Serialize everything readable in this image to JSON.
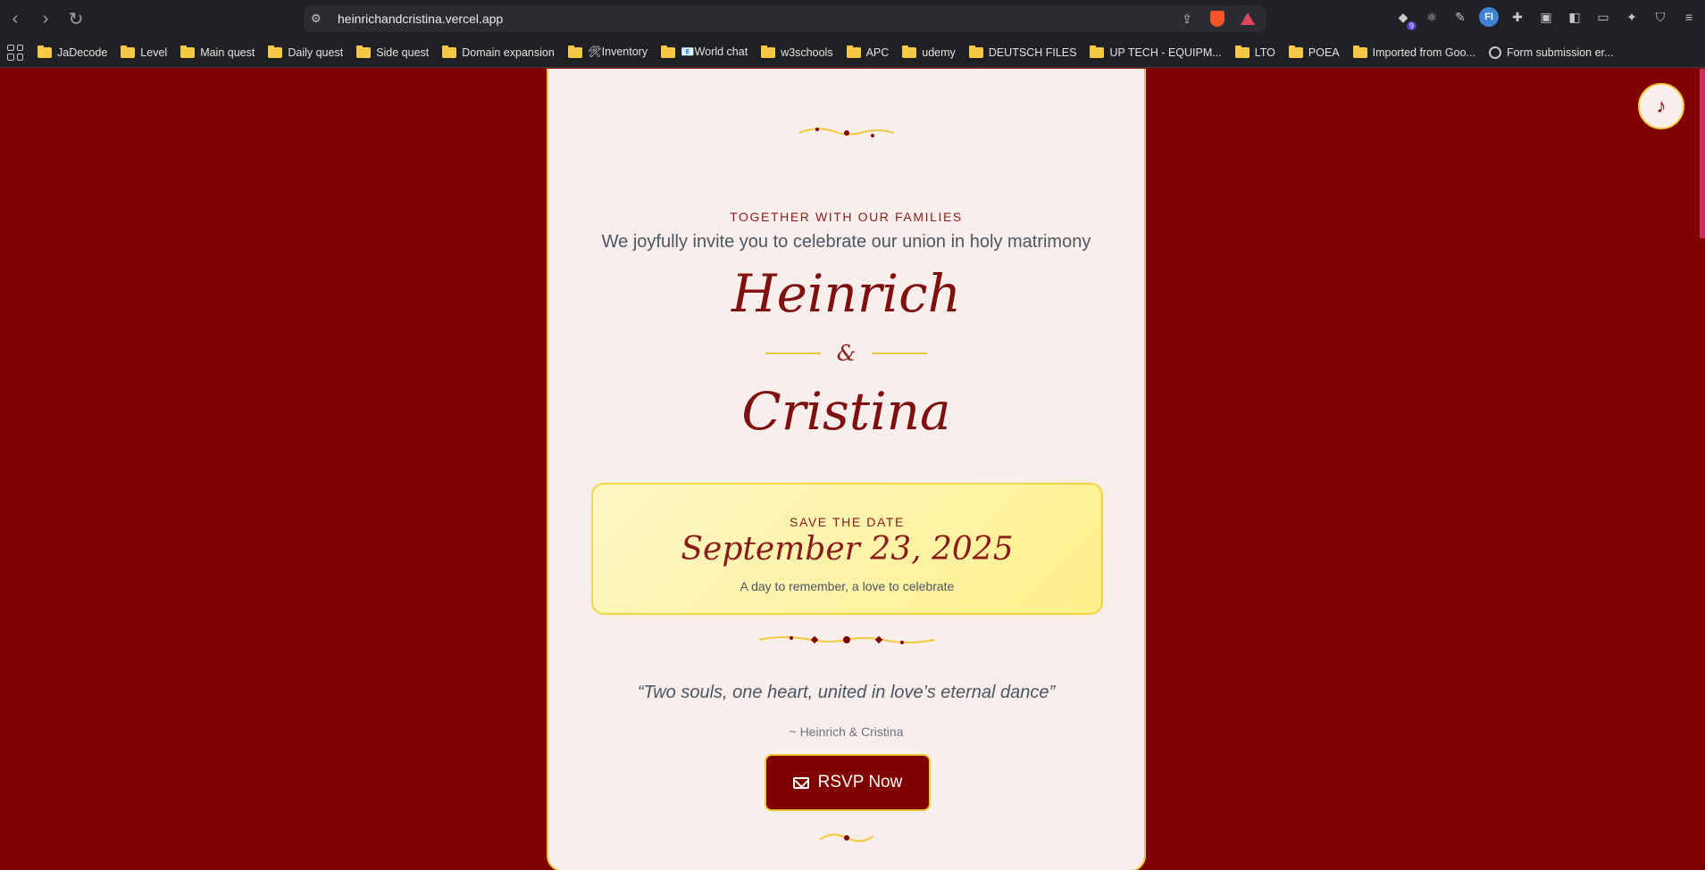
{
  "browser": {
    "url": "heinrichandcristina.vercel.app",
    "extension_badge": "9",
    "extension_fi": "FI"
  },
  "bookmarks": [
    {
      "label": "JaDecode"
    },
    {
      "label": "Level"
    },
    {
      "label": "Main quest"
    },
    {
      "label": "Daily quest"
    },
    {
      "label": "Side quest"
    },
    {
      "label": "Domain expansion"
    },
    {
      "label": "🛠Inventory"
    },
    {
      "label": "📧World chat"
    },
    {
      "label": "w3schools"
    },
    {
      "label": "APC"
    },
    {
      "label": "udemy"
    },
    {
      "label": "DEUTSCH FILES"
    },
    {
      "label": "UP TECH - EQUIPM..."
    },
    {
      "label": "LTO"
    },
    {
      "label": "POEA"
    },
    {
      "label": "Imported from Goo..."
    },
    {
      "label": "Form submission er..."
    }
  ],
  "invitation": {
    "families": "TOGETHER WITH OUR FAMILIES",
    "invite_line": "We joyfully invite you to celebrate our union in holy matrimony",
    "name1": "Heinrich",
    "ampersand": "&",
    "name2": "Cristina",
    "save_label": "SAVE THE DATE",
    "date": "September 23, 2025",
    "date_sub": "A day to remember, a love to celebrate",
    "quote": "“Two souls, one heart, united in love’s eternal dance”",
    "quote_author": "~ Heinrich & Cristina",
    "rsvp_label": "RSVP Now"
  },
  "colors": {
    "background": "#800000",
    "card": "#f8efec",
    "gold": "#f2c93c",
    "accent_text": "#8b1a1a"
  },
  "icons": {
    "music": "music-note-icon",
    "rsvp": "mail-icon"
  }
}
